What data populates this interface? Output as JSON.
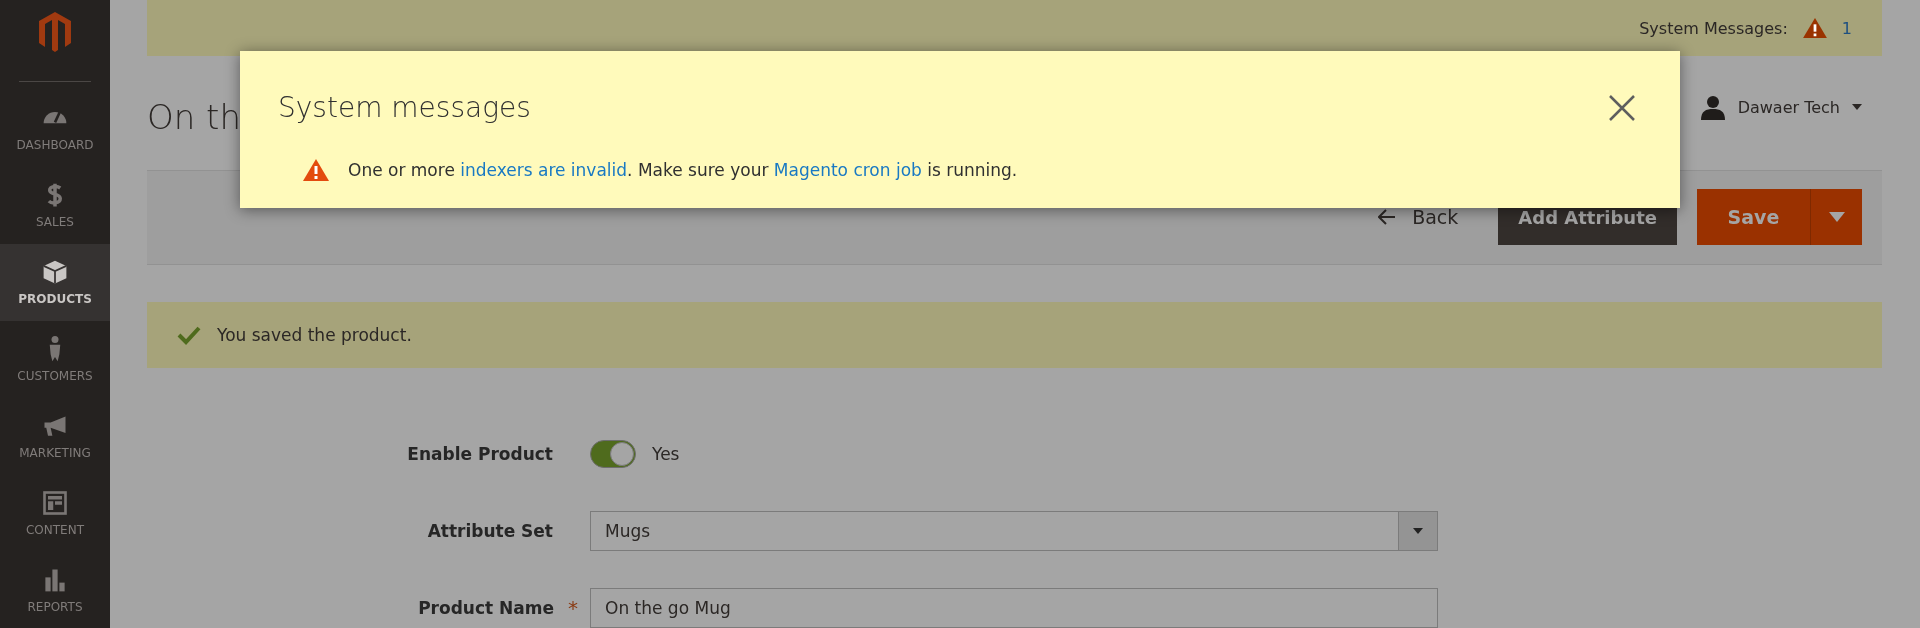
{
  "sidebar": {
    "items": [
      {
        "label": "DASHBOARD",
        "selected": false
      },
      {
        "label": "SALES",
        "selected": false
      },
      {
        "label": "PRODUCTS",
        "selected": true
      },
      {
        "label": "CUSTOMERS",
        "selected": false
      },
      {
        "label": "MARKETING",
        "selected": false
      },
      {
        "label": "CONTENT",
        "selected": false
      },
      {
        "label": "REPORTS",
        "selected": false
      }
    ]
  },
  "system_messages_bar": {
    "label": "System Messages:",
    "count": "1"
  },
  "page_title": "On th",
  "user_menu": {
    "name": "Dawaer Tech"
  },
  "actions": {
    "back": "Back",
    "add_attribute": "Add Attribute",
    "save": "Save"
  },
  "success_message": "You saved the product.",
  "form": {
    "fields": [
      {
        "kind": "toggle",
        "label": "Enable Product",
        "on": true,
        "value": "Yes"
      },
      {
        "kind": "select",
        "label": "Attribute Set",
        "value": "Mugs"
      },
      {
        "kind": "text",
        "label": "Product Name",
        "required_mark": "*",
        "value": "On the go Mug"
      }
    ]
  },
  "modal": {
    "title": "System messages",
    "message": [
      {
        "kind": "text",
        "text": "One or more "
      },
      {
        "kind": "link",
        "text": "indexers are invalid"
      },
      {
        "kind": "text",
        "text": ". Make sure your "
      },
      {
        "kind": "link",
        "text": "Magento cron job"
      },
      {
        "kind": "text",
        "text": " is running."
      }
    ]
  }
}
